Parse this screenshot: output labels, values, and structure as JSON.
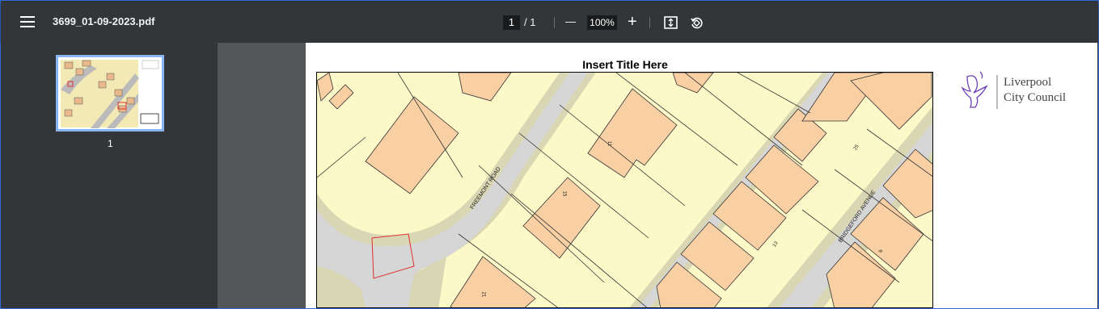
{
  "toolbar": {
    "filename": "3699_01-09-2023.pdf",
    "page_current": "1",
    "page_total": "/ 1",
    "zoom": "100%",
    "zoom_out_glyph": "—",
    "zoom_in_glyph": "+"
  },
  "sidebar": {
    "thumbnail_page_number": "1"
  },
  "document": {
    "title": "Insert Title Here",
    "logo_line1": "Liverpool",
    "logo_line2": "City Council",
    "map_labels": {
      "road1": "FREEMONT ROAD",
      "road2": "BRIDGEFORD AVENUE",
      "house1": "11",
      "house2": "15",
      "house3": "21",
      "house4": "25",
      "house5": "13",
      "house6": "9"
    }
  },
  "colors": {
    "toolbar_bg": "#323639",
    "gutter_bg": "#525659",
    "map_land": "#fdf8c8",
    "map_building": "#f9cfa4",
    "map_road": "#d6d6d6",
    "map_verge": "#d9d7b3",
    "highlight_red": "#e03030",
    "accent": "#8ab4f8"
  }
}
